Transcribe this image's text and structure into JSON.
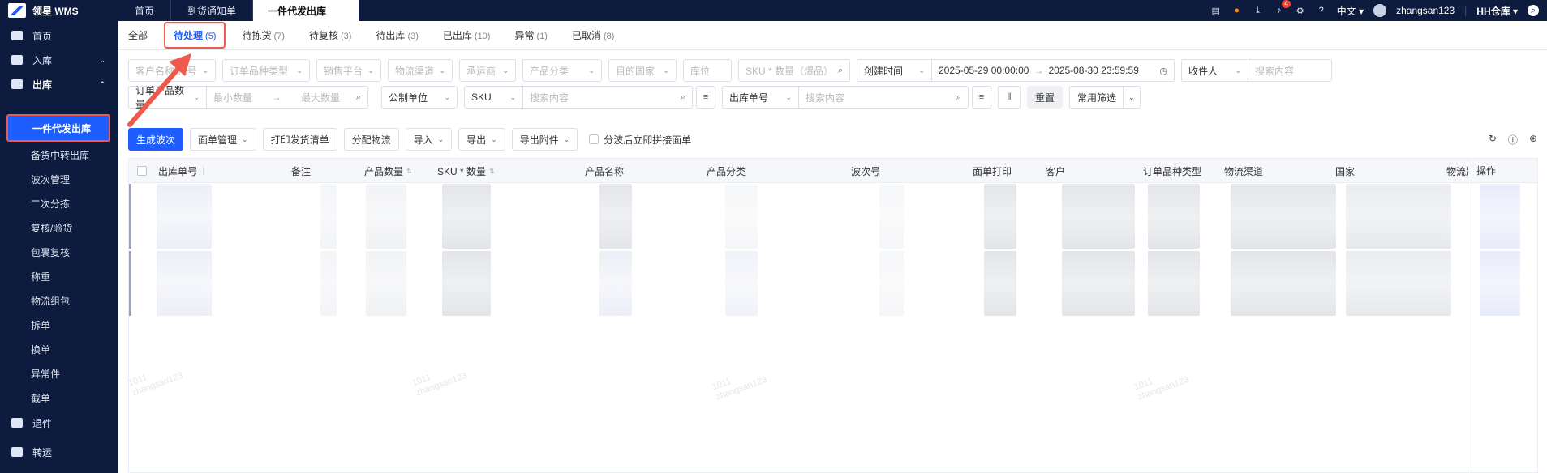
{
  "app": {
    "logo_text": "领星 WMS"
  },
  "top_tabs": [
    {
      "label": "首页"
    },
    {
      "label": "到货通知单"
    },
    {
      "label": "一件代发出库",
      "active": true
    }
  ],
  "top_right": {
    "notification_count": "4",
    "language": "中文",
    "username": "zhangsan123",
    "warehouse": "HH仓库"
  },
  "sidebar": {
    "groups": [
      {
        "label": "首页",
        "icon": "home-icon"
      },
      {
        "label": "入库",
        "icon": "inbound-icon"
      },
      {
        "label": "出库",
        "icon": "outbound-icon"
      },
      {
        "label": "退件",
        "icon": "return-icon"
      },
      {
        "label": "转运",
        "icon": "transfer-icon"
      }
    ],
    "items": [
      {
        "label": "一件代发出库",
        "active": true
      },
      {
        "label": "备货中转出库"
      },
      {
        "label": "波次管理"
      },
      {
        "label": "二次分拣"
      },
      {
        "label": "复核/验货"
      },
      {
        "label": "包裹复核"
      },
      {
        "label": "称重"
      },
      {
        "label": "物流组包"
      },
      {
        "label": "拆单"
      },
      {
        "label": "换单"
      },
      {
        "label": "异常件"
      },
      {
        "label": "截单"
      }
    ]
  },
  "status_tabs": [
    {
      "label": "全部",
      "count": ""
    },
    {
      "label": "待处理",
      "count": "(5)",
      "active": true
    },
    {
      "label": "待拣货",
      "count": "(7)"
    },
    {
      "label": "待复核",
      "count": "(3)"
    },
    {
      "label": "待出库",
      "count": "(3)"
    },
    {
      "label": "已出库",
      "count": "(10)"
    },
    {
      "label": "异常",
      "count": "(1)"
    },
    {
      "label": "已取消",
      "count": "(8)"
    }
  ],
  "filters": {
    "customer": "客户名称/代号",
    "order_type": "订单品种类型",
    "platform": "销售平台",
    "logistics_channel": "物流渠道",
    "carrier": "承运商",
    "product_category": "产品分类",
    "destination": "目的国家",
    "location": "库位",
    "sku_qty": "SKU * 数量（爆品）",
    "time_type": "创建时间",
    "date_start": "2025-05-29 00:00:00",
    "date_end": "2025-08-30 23:59:59",
    "receiver": "收件人",
    "search_placeholder": "搜索内容",
    "order_product_qty": "订单产品数量",
    "min_qty": "最小数量",
    "max_qty": "最大数量",
    "unit": "公制单位",
    "sku": "SKU",
    "outbound_no": "出库单号",
    "reset": "重置",
    "common_filter": "常用筛选"
  },
  "toolbar": {
    "generate_wave": "生成波次",
    "waybill_mgmt": "面单管理",
    "print_list": "打印发货清单",
    "assign_logistics": "分配物流",
    "import": "导入",
    "export": "导出",
    "export_attachment": "导出附件",
    "split_print": "分波后立即拼接面单"
  },
  "table": {
    "columns": [
      "出库单号",
      "备注",
      "产品数量",
      "SKU * 数量",
      "产品名称",
      "产品分类",
      "波次号",
      "面单打印",
      "客户",
      "订单品种类型",
      "物流渠道",
      "国家",
      "物流跟踪",
      "操作"
    ]
  },
  "watermark": {
    "line1": "1011",
    "line2": "zhangsan123"
  }
}
